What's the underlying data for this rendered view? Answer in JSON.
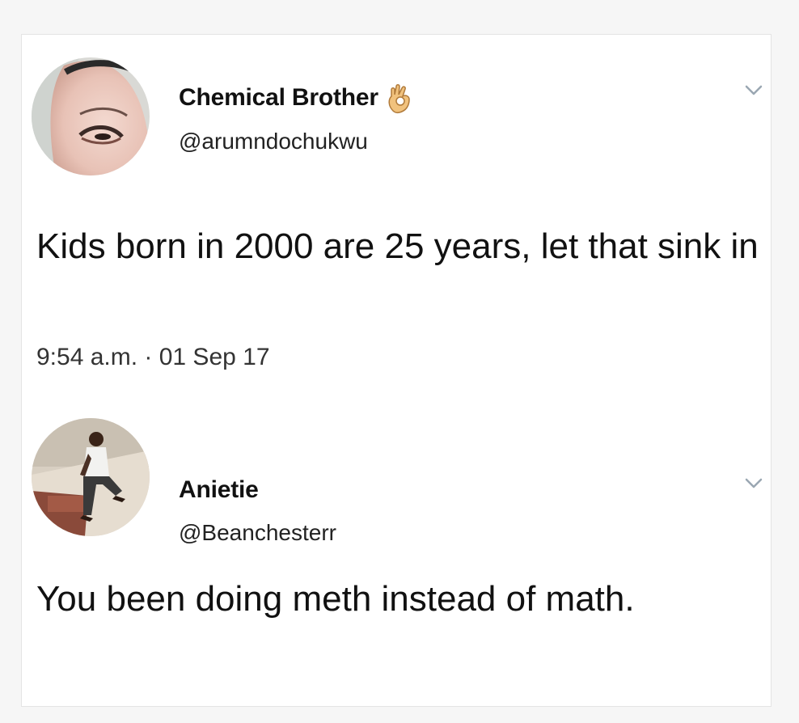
{
  "tweets": [
    {
      "display_name": "Chemical Brother",
      "name_emoji": "ok-hand-emoji",
      "handle": "@arumndochukwu",
      "text": "Kids born in 2000 are 25 years, let that sink in",
      "timestamp": "9:54 a.m. · 01 Sep 17",
      "menu_icon": "chevron-down-icon"
    },
    {
      "display_name": "Anietie",
      "handle": "@Beanchesterr",
      "text": "You been doing meth instead of math.",
      "menu_icon": "chevron-down-icon"
    }
  ],
  "colors": {
    "page_background": "#f6f6f6",
    "card_background": "#ffffff",
    "text": "#111111",
    "muted_text": "#333333",
    "chevron": "#9aa7b2"
  }
}
